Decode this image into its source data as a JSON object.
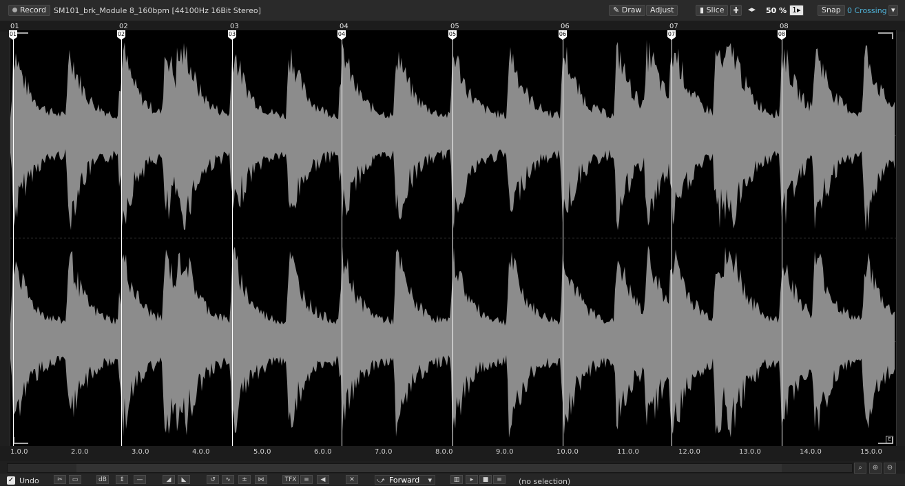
{
  "toolbar": {
    "record_label": "Record",
    "title": "SM101_brk_Module 8_160bpm [44100Hz 16Bit Stereo]",
    "draw_label": "Draw",
    "adjust_label": "Adjust",
    "slice_label": "Slice",
    "zoom": "50 %",
    "snap_label": "Snap",
    "crossing": "0 Crossing"
  },
  "bars": [
    "01",
    "02",
    "03",
    "04",
    "05",
    "06",
    "07",
    "08"
  ],
  "slices": [
    "01",
    "02",
    "03",
    "04",
    "05",
    "06",
    "07",
    "08"
  ],
  "timeline": [
    "1.0.0",
    "2.0.0",
    "3.0.0",
    "4.0.0",
    "5.0.0",
    "6.0.0",
    "7.0.0",
    "8.0.0",
    "9.0.0",
    "10.0.0",
    "11.0.0",
    "12.0.0",
    "13.0.0",
    "14.0.0",
    "15.0.0"
  ],
  "bottom": {
    "undo_label": "Undo",
    "direction": "Forward",
    "selection_status": "(no selection)"
  },
  "colors": {
    "waveform": "#8c8c8c",
    "background": "#000000",
    "accent": "#4fb3d9"
  }
}
